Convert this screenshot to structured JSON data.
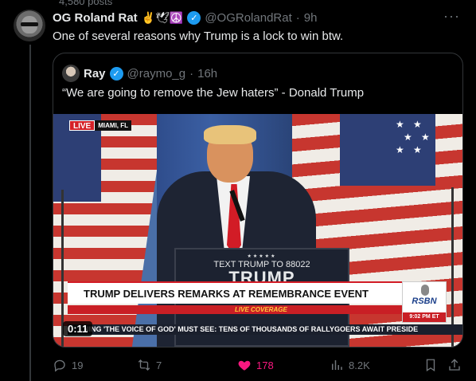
{
  "profile": {
    "posts_count": "4,580 posts"
  },
  "tweet": {
    "display_name": "OG Roland Rat",
    "emojis": "✌️🕊☮️",
    "handle": "@OGRolandRat",
    "dot": "·",
    "time": "9h",
    "more": "···",
    "text": "One of several reasons why Trump is a lock to win btw."
  },
  "quote": {
    "display_name": "Ray",
    "handle": "@raymo_g",
    "dot": "·",
    "time": "16h",
    "text": "“We are going to remove the Jew haters” - Donald Trump",
    "video": {
      "live_label": "LIVE",
      "location": "MIAMI, FL",
      "podium_stars": "★★★★★",
      "podium_line1": "TEXT TRUMP TO 88022",
      "podium_line2": "TRUMP",
      "headline": "TRUMP DELIVERS REMARKS AT REMEMBRANCE EVENT",
      "coverage": "LIVE COVERAGE",
      "network": "RSBN",
      "clock": "9:02 PM ET",
      "ticker": "NING 'THE VOICE OF GOD'    MUST SEE: TENS OF THOUSANDS OF RALLYGOERS AWAIT PRESIDE",
      "timestamp": "0:11"
    }
  },
  "actions": {
    "replies": "19",
    "reposts": "7",
    "likes": "178",
    "views": "8.2K"
  },
  "colors": {
    "background": "#000000",
    "text": "#e7e9ea",
    "muted": "#71767b",
    "verified": "#1d9bf0",
    "like": "#f91880"
  }
}
